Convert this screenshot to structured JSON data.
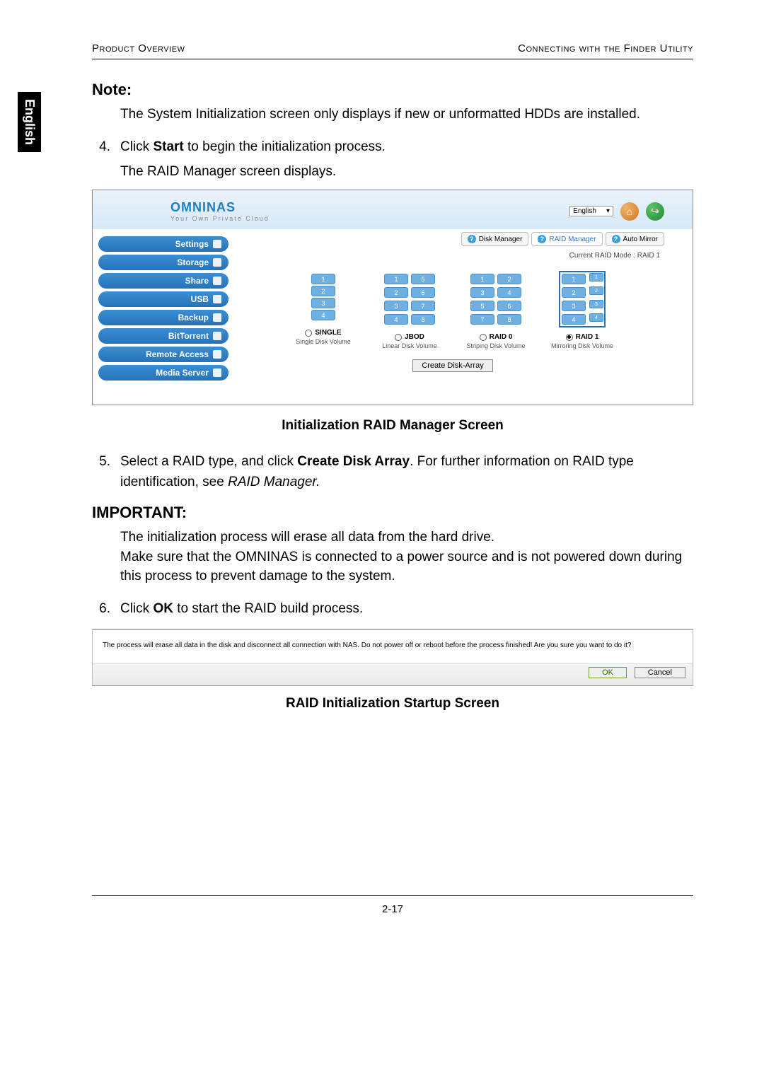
{
  "lang_tab": "English",
  "header": {
    "left": "Product Overview",
    "right": "Connecting with the Finder Utility"
  },
  "note": {
    "heading": "Note:",
    "body": "The System Initialization screen only displays if new or unformatted HDDs are installed."
  },
  "steps": {
    "s4_num": "4.",
    "s4_a": "Click ",
    "s4_b": "Start",
    "s4_c": " to begin the initialization process.",
    "s4_sub": "The RAID Manager screen displays.",
    "s5_num": "5.",
    "s5_a": "Select a RAID type, and click ",
    "s5_b": "Create Disk Array",
    "s5_c": ". For further information on RAID type identification, see ",
    "s5_d": "RAID Manager.",
    "s6_num": "6.",
    "s6_a": "Click ",
    "s6_b": "OK",
    "s6_c": " to start the RAID build process."
  },
  "app": {
    "logo": "OMNINAS",
    "logo_sub": "Your Own Private Cloud",
    "lang": "English",
    "nav": {
      "settings": "Settings",
      "storage": "Storage",
      "share": "Share",
      "usb": "USB",
      "backup": "Backup",
      "bittorrent": "BitTorrent",
      "remote": "Remote Access",
      "media": "Media Server"
    },
    "tabs": {
      "disk": "Disk Manager",
      "raid": "RAID Manager",
      "auto": "Auto Mirror"
    },
    "status": "Current RAID Mode : RAID 1",
    "raid_options": {
      "single": {
        "label": "SINGLE",
        "desc": "Single Disk Volume"
      },
      "jbod": {
        "label": "JBOD",
        "desc": "Linear Disk Volume"
      },
      "raid0": {
        "label": "RAID 0",
        "desc": "Striping Disk Volume"
      },
      "raid1": {
        "label": "RAID 1",
        "desc": "Mirroring Disk Volume"
      }
    },
    "create_btn": "Create Disk-Array"
  },
  "caption1": "Initialization RAID Manager Screen",
  "important": {
    "heading": "IMPORTANT:",
    "body": "The initialization process will erase all data from the hard drive.\nMake sure that the OMNINAS is connected to a power source and is not powered down during this process to prevent damage to the system."
  },
  "dialog": {
    "msg": "The process will erase all data in the disk and disconnect all connection with NAS. Do not power off or reboot before the process finished! Are you sure you want to do it?",
    "ok": "OK",
    "cancel": "Cancel"
  },
  "caption2": "RAID Initialization Startup Screen",
  "page_num": "2-17"
}
